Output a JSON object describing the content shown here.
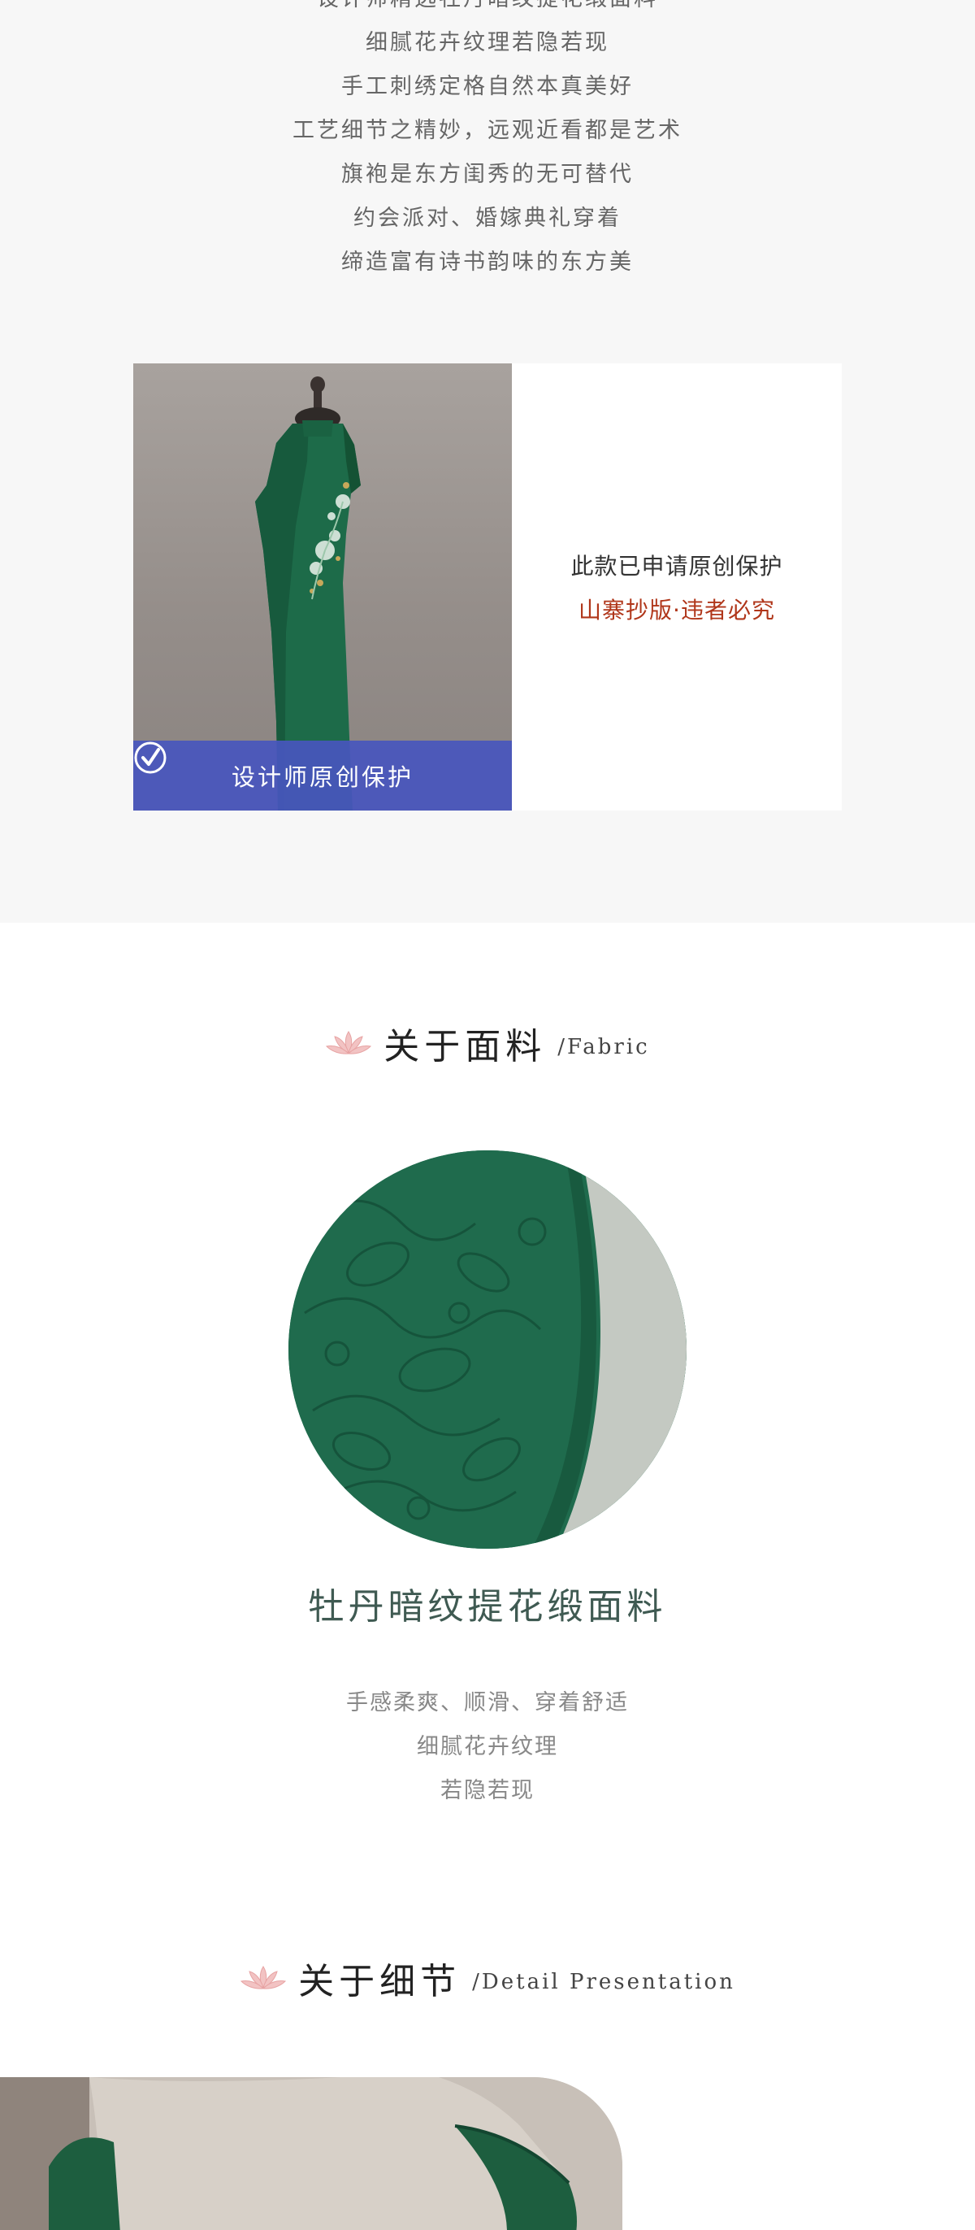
{
  "intro": {
    "lines": [
      "设计师精选牡丹暗纹提花缎面料",
      "细腻花卉纹理若隐若现",
      "手工刺绣定格自然本真美好",
      "工艺细节之精妙，远观近看都是艺术",
      "旗袍是东方闺秀的无可替代",
      "约会派对、婚嫁典礼穿着",
      "缔造富有诗书韵味的东方美"
    ]
  },
  "protection": {
    "badge_label": "设计师原创保护",
    "line1": "此款已申请原创保护",
    "line2": "山寨抄版·违者必究",
    "badge_color": "#4856be",
    "warning_color": "#b0361a"
  },
  "fabric_section": {
    "title": "关于面料",
    "subtitle": "/Fabric",
    "fabric_name": "牡丹暗纹提花缎面料",
    "description": [
      "手感柔爽、顺滑、穿着舒适",
      "细腻花卉纹理",
      "若隐若现"
    ],
    "fabric_color": "#1e6a4c"
  },
  "detail_section": {
    "title": "关于细节",
    "subtitle": "/Detail Presentation"
  },
  "icons": {
    "lotus": "lotus-icon",
    "check": "check-circle-icon"
  }
}
